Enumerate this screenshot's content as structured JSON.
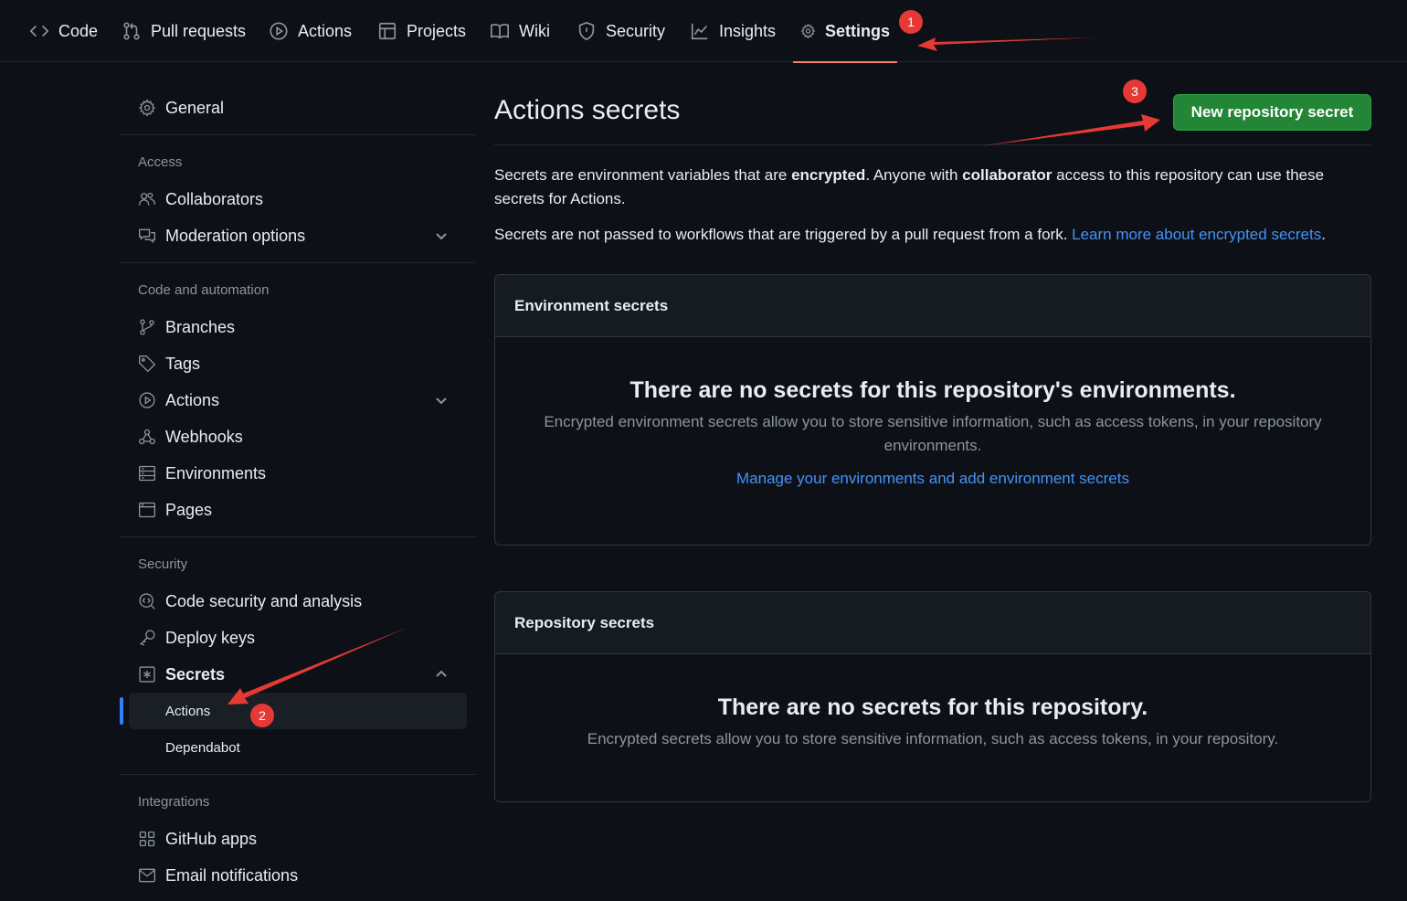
{
  "topnav": {
    "tabs": [
      {
        "label": "Code",
        "icon": "code-icon"
      },
      {
        "label": "Pull requests",
        "icon": "pull-request-icon"
      },
      {
        "label": "Actions",
        "icon": "play-icon"
      },
      {
        "label": "Projects",
        "icon": "table-icon"
      },
      {
        "label": "Wiki",
        "icon": "book-icon"
      },
      {
        "label": "Security",
        "icon": "shield-icon"
      },
      {
        "label": "Insights",
        "icon": "graph-icon"
      },
      {
        "label": "Settings",
        "icon": "gear-icon",
        "active": true
      }
    ]
  },
  "sidebar": {
    "general": "General",
    "access_heading": "Access",
    "collaborators": "Collaborators",
    "moderation": "Moderation options",
    "code_heading": "Code and automation",
    "branches": "Branches",
    "tags": "Tags",
    "actions": "Actions",
    "webhooks": "Webhooks",
    "environments": "Environments",
    "pages": "Pages",
    "security_heading": "Security",
    "code_security": "Code security and analysis",
    "deploy_keys": "Deploy keys",
    "secrets": "Secrets",
    "secrets_actions": "Actions",
    "secrets_dependabot": "Dependabot",
    "integrations_heading": "Integrations",
    "github_apps": "GitHub apps",
    "email_notifications": "Email notifications"
  },
  "main": {
    "title": "Actions secrets",
    "new_button": "New repository secret",
    "intro_1a": "Secrets are environment variables that are ",
    "intro_1b": "encrypted",
    "intro_1c": ". Anyone with ",
    "intro_1d": "collaborator",
    "intro_1e": " access to this repository can use these secrets for Actions.",
    "intro_2a": "Secrets are not passed to workflows that are triggered by a pull request from a fork. ",
    "intro_2_link": "Learn more about encrypted secrets",
    "intro_2b": ".",
    "env_box": {
      "header": "Environment secrets",
      "empty_title": "There are no secrets for this repository's environments.",
      "empty_desc": "Encrypted environment secrets allow you to store sensitive information, such as access tokens, in your repository environments.",
      "link": "Manage your environments and add environment secrets"
    },
    "repo_box": {
      "header": "Repository secrets",
      "empty_title": "There are no secrets for this repository.",
      "empty_desc": "Encrypted secrets allow you to store sensitive information, such as access tokens, in your repository."
    }
  },
  "annotations": {
    "badge_1": "1",
    "badge_2": "2",
    "badge_3": "3",
    "color": "#e53935"
  },
  "colors": {
    "background": "#0d1117",
    "accent_link": "#4493f8",
    "button_green": "#238636",
    "active_tab_underline": "#f78166",
    "active_bar": "#2f81f7"
  }
}
